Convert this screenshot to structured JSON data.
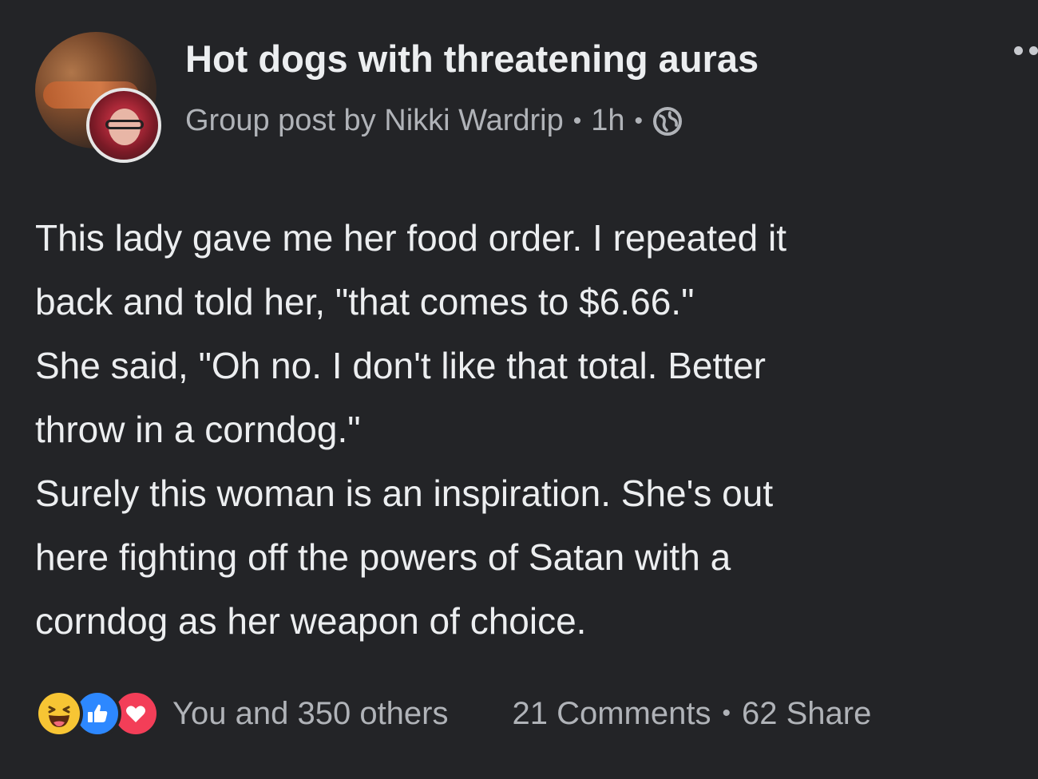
{
  "post": {
    "group_name": "Hot dogs with threatening auras",
    "meta_text": "Group post by Nikki Wardrip",
    "time": "1h",
    "separator": "•",
    "icons": {
      "audience": "globe-icon",
      "more": "more-options-icon",
      "group_avatar": "group-avatar",
      "user_avatar": "user-avatar"
    },
    "body": [
      "This lady gave me her food order. I repeated it",
      "back and told her, \"that comes to $6.66.\"",
      "She said, \"Oh no. I don't like that total. Better",
      "throw in a corndog.\"",
      "Surely this woman is an inspiration. She's out",
      "here fighting off the powers of Satan with a",
      "corndog as her weapon of choice."
    ],
    "footer": {
      "reactions_text": "You and 350 others",
      "comments_text": "21 Comments",
      "shares_text": "62 Share",
      "reaction_icons": [
        "haha-reaction-icon",
        "like-reaction-icon",
        "love-reaction-icon"
      ]
    }
  },
  "colors": {
    "background": "#232427",
    "primary_text": "#eceef0",
    "secondary_text": "#b0b3b8",
    "like_blue": "#2d88ff",
    "love_red": "#f33e58",
    "haha_yellow": "#f7c534"
  }
}
